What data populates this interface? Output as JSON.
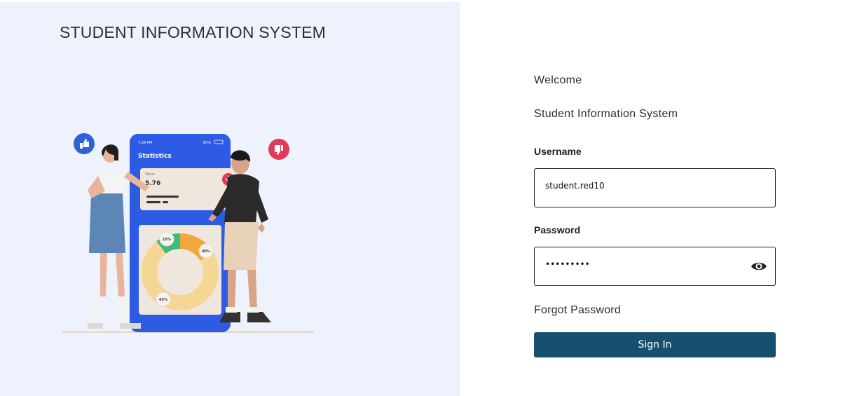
{
  "header": {
    "title": "STUDENT INFORMATION SYSTEM"
  },
  "illustration": {
    "phone_time": "7:29 PM",
    "phone_battery": "80%",
    "phone_heading": "Statistics",
    "card_label": "Value",
    "card_value": "5.76",
    "donut_labels": [
      "15%",
      "40%",
      "45%"
    ]
  },
  "login": {
    "welcome": "Welcome",
    "subtitle": "Student Information System",
    "username_label": "Username",
    "username_value": "student.red10",
    "password_label": "Password",
    "password_value": "•••••••••",
    "forgot_label": "Forgot Password",
    "signin_label": "Sign In"
  },
  "colors": {
    "left_bg": "#eef2fd",
    "primary_button": "#17506f",
    "phone_blue": "#2d5be3",
    "like_blue": "#2f62d8",
    "dislike_red": "#e03a58"
  },
  "icons": {
    "password_toggle": "eye-icon",
    "like": "thumbs-up-icon",
    "dislike": "thumbs-down-icon"
  }
}
